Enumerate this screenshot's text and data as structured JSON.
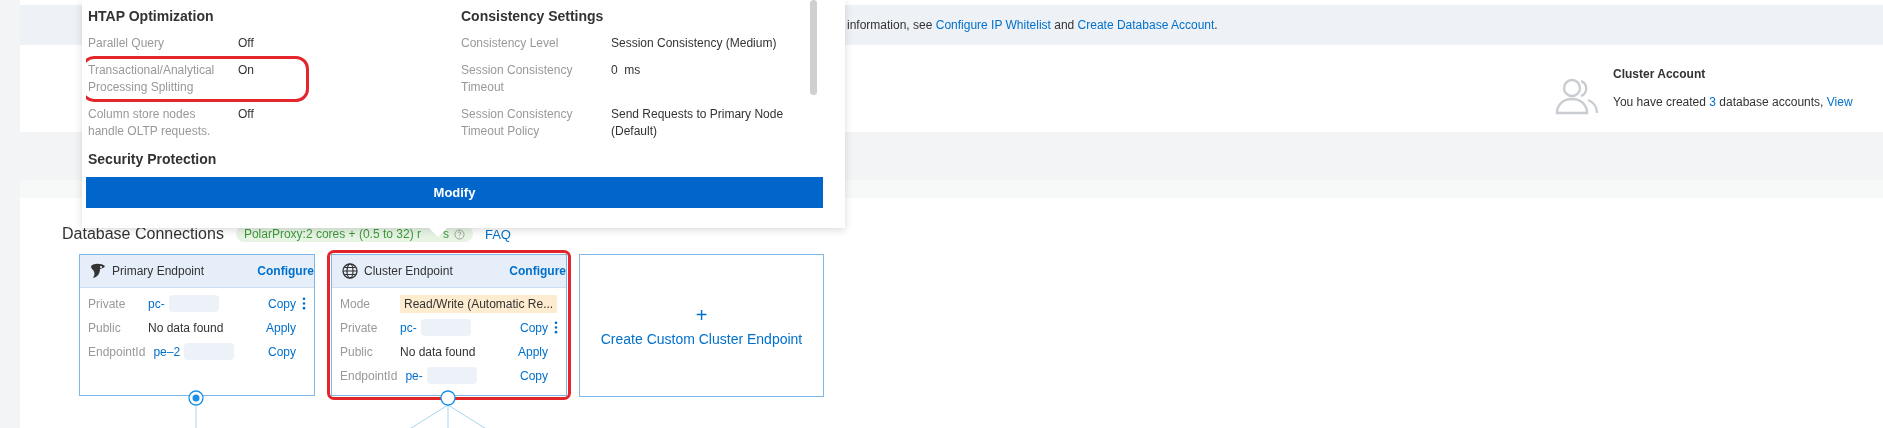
{
  "info_bar": {
    "segments": [
      {
        "kind": "text",
        "text": "information, see "
      },
      {
        "kind": "link",
        "text": "Configure IP Whitelist"
      },
      {
        "kind": "text",
        "text": " and "
      },
      {
        "kind": "link",
        "text": "Create Database Account"
      },
      {
        "kind": "text",
        "text": "."
      }
    ]
  },
  "cluster_account": {
    "title": "Cluster Account",
    "text_before": "You have created ",
    "count": "3",
    "text_after": " database accounts, ",
    "link": "View"
  },
  "popup": {
    "sections": [
      {
        "title": "HTAP Optimization",
        "rows": [
          {
            "label": "Parallel Query",
            "value": "Off"
          },
          {
            "label": "Transactional/Analytical Processing Splitting",
            "value": "On",
            "highlighted": true
          },
          {
            "label": "Column store nodes handle OLTP requests.",
            "value": "Off"
          }
        ]
      },
      {
        "title": "Consistency Settings",
        "rows": [
          {
            "label": "Consistency Level",
            "value": "Session Consistency (Medium)"
          },
          {
            "label": "Session Consistency Timeout",
            "value": "0  ms"
          },
          {
            "label": "Session Consistency Timeout Policy",
            "value": "Send Requests to Primary Node (Default)"
          }
        ]
      }
    ],
    "cut_heading": "Security Protection",
    "button": "Modify"
  },
  "connections": {
    "title": "Database Connections",
    "badge": "PolarProxy:2 cores + (0.5 to 32) r",
    "badge_tail": "s",
    "faq": "FAQ",
    "endpoints": [
      {
        "kind": "primary",
        "title": "Primary Endpoint",
        "configure": "Configure",
        "highlighted": false,
        "rows": [
          {
            "label": "Private",
            "value": "pc-",
            "kind": "masked",
            "action": "Copy",
            "more": true
          },
          {
            "label": "Public",
            "value": "No data found",
            "kind": "text",
            "action": "Apply"
          },
          {
            "label": "EndpointId",
            "value": "pe–2",
            "kind": "masked",
            "action": "Copy"
          }
        ]
      },
      {
        "kind": "cluster",
        "title": "Cluster Endpoint",
        "configure": "Configure",
        "highlighted": true,
        "rows": [
          {
            "label": "Mode",
            "value": "Read/Write (Automatic Re...",
            "kind": "mode"
          },
          {
            "label": "Private",
            "value": "pc-",
            "kind": "masked",
            "action": "Copy",
            "more": true
          },
          {
            "label": "Public",
            "value": "No data found",
            "kind": "text",
            "action": "Apply"
          },
          {
            "label": "EndpointId",
            "value": "pe-",
            "kind": "masked",
            "action": "Copy"
          }
        ]
      }
    ],
    "create_card": {
      "icon": "+",
      "label": "Create Custom Cluster Endpoint"
    }
  }
}
